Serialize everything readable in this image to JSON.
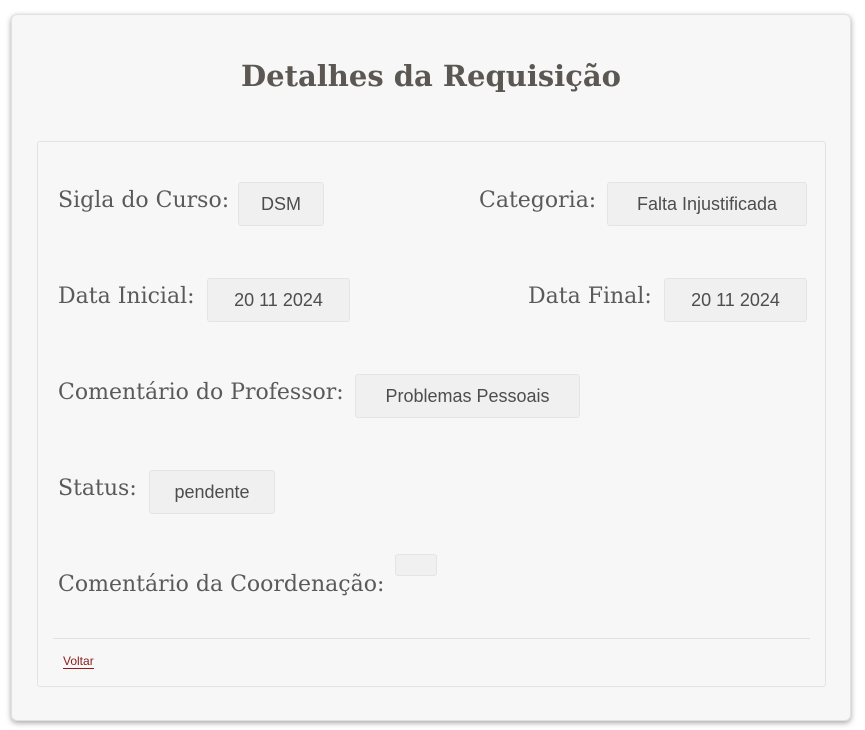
{
  "page": {
    "title": "Detalhes da Requisição"
  },
  "fields": {
    "sigla_label": "Sigla do Curso:",
    "sigla_value": "DSM",
    "categoria_label": "Categoria:",
    "categoria_value": "Falta Injustificada",
    "data_inicial_label": "Data Inicial:",
    "data_inicial_value": "20 11 2024",
    "data_final_label": "Data Final:",
    "data_final_value": "20 11 2024",
    "comentario_prof_label": "Comentário do Professor:",
    "comentario_prof_value": "Problemas Pessoais",
    "status_label": "Status:",
    "status_value": "pendente",
    "comentario_coord_label": "Comentário da Coordenação:",
    "comentario_coord_value": ""
  },
  "footer": {
    "back_label": "Voltar"
  },
  "colors": {
    "accent_link": "#8b1c1c",
    "text": "#5a5a5a",
    "card_bg": "#f7f7f7"
  }
}
